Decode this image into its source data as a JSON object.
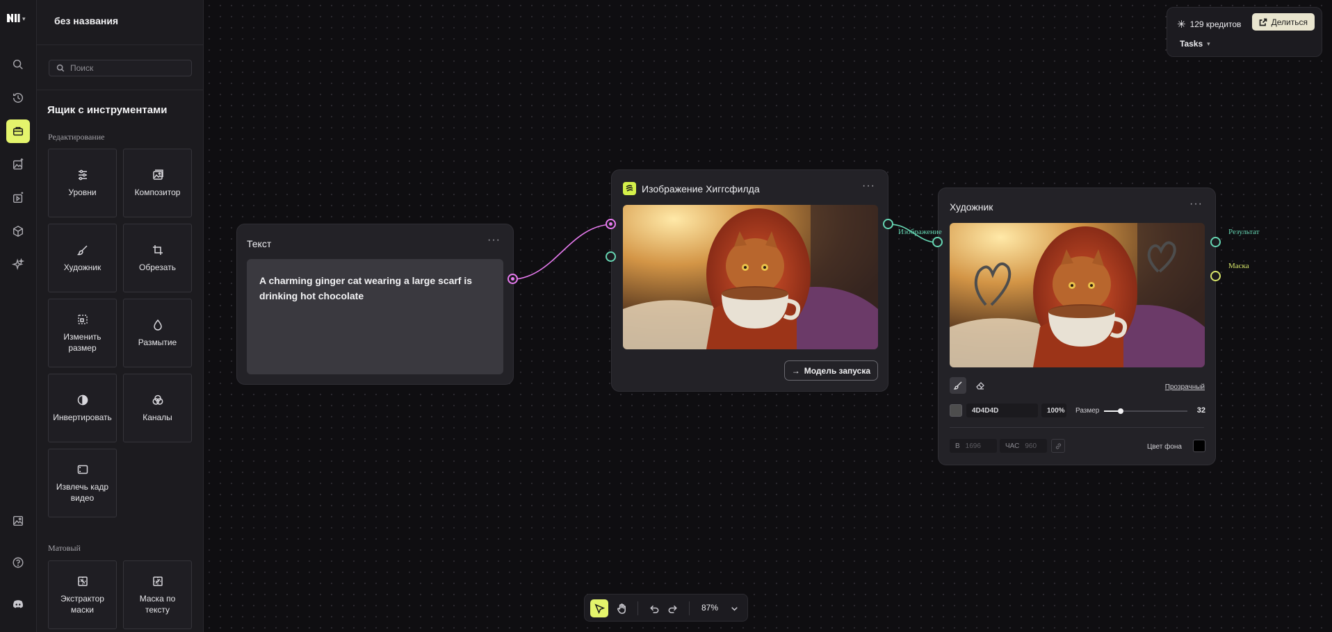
{
  "app": {
    "document_title": "без названия",
    "accent": "#e4f46c"
  },
  "rail": {
    "items": [
      {
        "icon": "search-icon"
      },
      {
        "icon": "history-icon"
      },
      {
        "icon": "toolbox-icon",
        "active": true
      },
      {
        "icon": "image-edit-icon"
      },
      {
        "icon": "video-icon"
      },
      {
        "icon": "cube-icon"
      },
      {
        "icon": "sparkle-icon"
      },
      {
        "icon": "gallery-icon"
      },
      {
        "icon": "help-icon"
      },
      {
        "icon": "discord-icon"
      }
    ]
  },
  "toolbox": {
    "search_placeholder": "Поиск",
    "title": "Ящик с инструментами",
    "sections": [
      {
        "label": "Редактирование",
        "tools": [
          {
            "label": "Уровни",
            "icon": "sliders-icon"
          },
          {
            "label": "Композитор",
            "icon": "images-icon"
          },
          {
            "label": "Художник",
            "icon": "brush-icon"
          },
          {
            "label": "Обрезать",
            "icon": "crop-icon"
          },
          {
            "label": "Изменить размер",
            "icon": "resize-icon"
          },
          {
            "label": "Размытие",
            "icon": "droplet-icon"
          },
          {
            "label": "Инвертировать",
            "icon": "contrast-icon"
          },
          {
            "label": "Каналы",
            "icon": "channels-icon"
          },
          {
            "label": "Извлечь кадр видео",
            "icon": "frame-icon"
          }
        ]
      },
      {
        "label": "Матовый",
        "tools": [
          {
            "label": "Экстрактор маски",
            "icon": "mask-icon"
          },
          {
            "label": "Маска по тексту",
            "icon": "mask-text-icon"
          }
        ]
      }
    ]
  },
  "header": {
    "credits": "129 кредитов",
    "share_label": "Делиться",
    "tasks_label": "Tasks"
  },
  "nodes": {
    "text": {
      "title": "Текст",
      "prompt": "A charming ginger cat wearing a large scarf is drinking hot chocolate"
    },
    "higgsfield": {
      "title": "Изображение Хиггсфилда",
      "run_label": "Модель запуска"
    },
    "painter": {
      "title": "Художник",
      "input_label": "Изображение",
      "output_result": "Результат",
      "output_mask": "Маска",
      "transparent_link": "Прозрачный",
      "color_hex": "4D4D4D",
      "opacity": "100%",
      "size_label": "Размер",
      "size_value": "32",
      "size_fraction": 0.2,
      "width_label": "В",
      "width_value": "1696",
      "height_label": "ЧАС",
      "height_value": "960",
      "bg_label": "Цвет фона",
      "brush_color": "#4d4d4d",
      "bg_color": "#000000"
    }
  },
  "bottom_toolbar": {
    "zoom": "87%"
  }
}
